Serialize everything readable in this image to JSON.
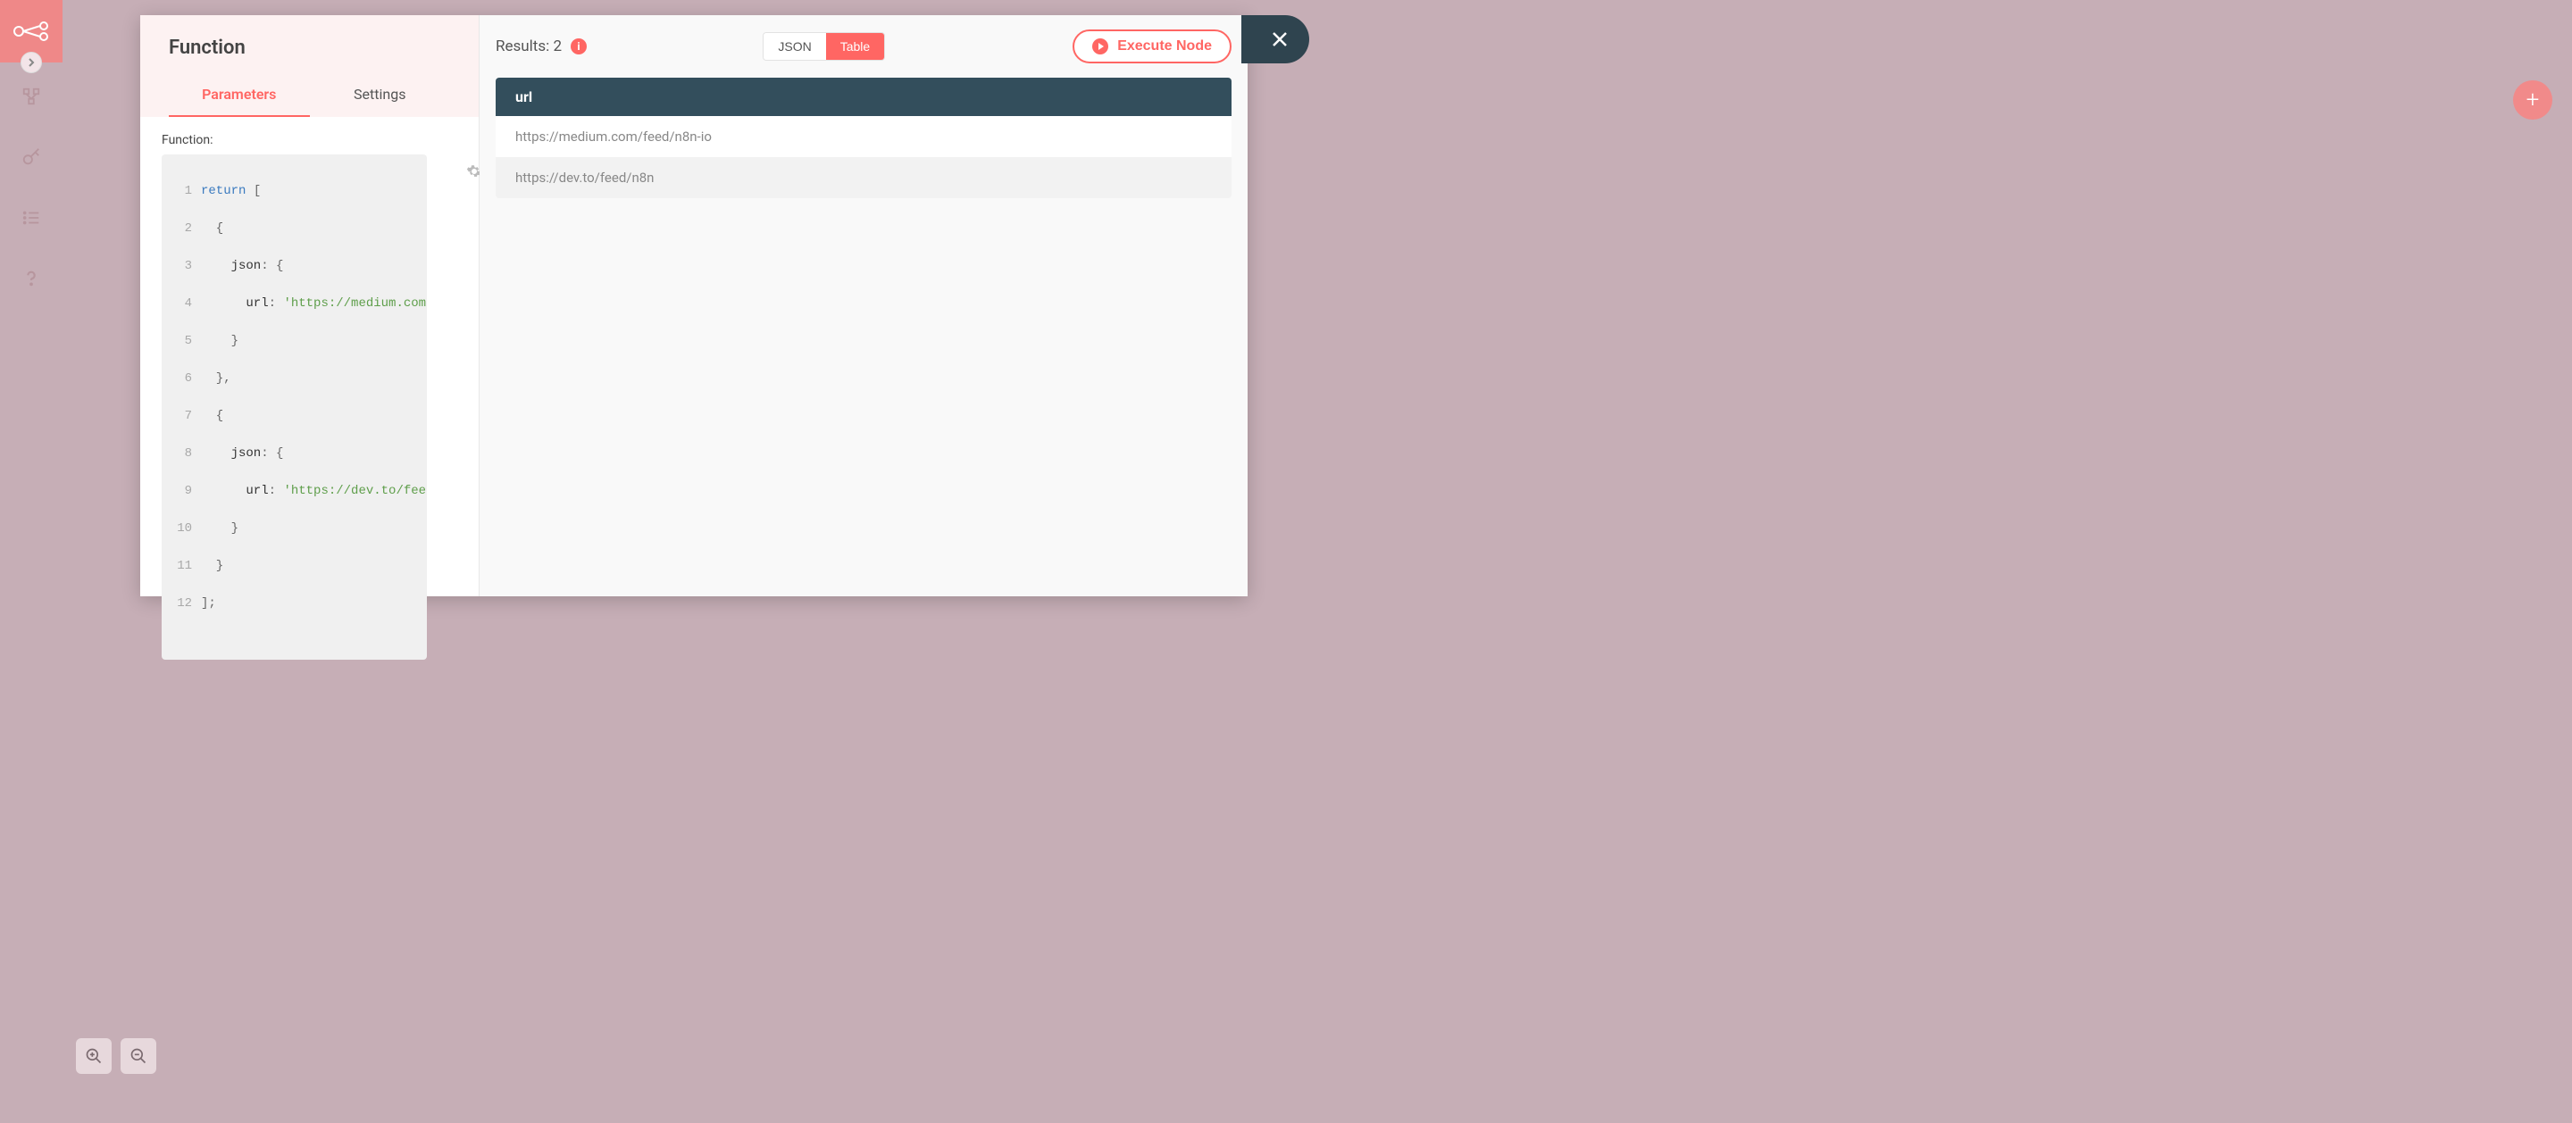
{
  "modal": {
    "title": "Function",
    "tabs": {
      "parameters": "Parameters",
      "settings": "Settings"
    },
    "param_label": "Function:",
    "execute_label": "Execute Node"
  },
  "code": {
    "l1_kw": "return",
    "l1_rest": " [",
    "l2": "  {",
    "l3_key": "    json",
    "l3_rest": ": {",
    "l4_key": "      url",
    "l4_colon": ": ",
    "l4_str": "'https://medium.com/",
    "l5": "    }",
    "l6": "  },",
    "l7": "  {",
    "l8_key": "    json",
    "l8_rest": ": {",
    "l9_key": "      url",
    "l9_colon": ": ",
    "l9_str": "'https://dev.to/feed",
    "l10": "    }",
    "l11": "  }",
    "l12": "];"
  },
  "results": {
    "label_prefix": "Results: ",
    "count": "2",
    "toggle_json": "JSON",
    "toggle_table": "Table",
    "header": "url",
    "rows": [
      "https://medium.com/feed/n8n-io",
      "https://dev.to/feed/n8n"
    ]
  }
}
